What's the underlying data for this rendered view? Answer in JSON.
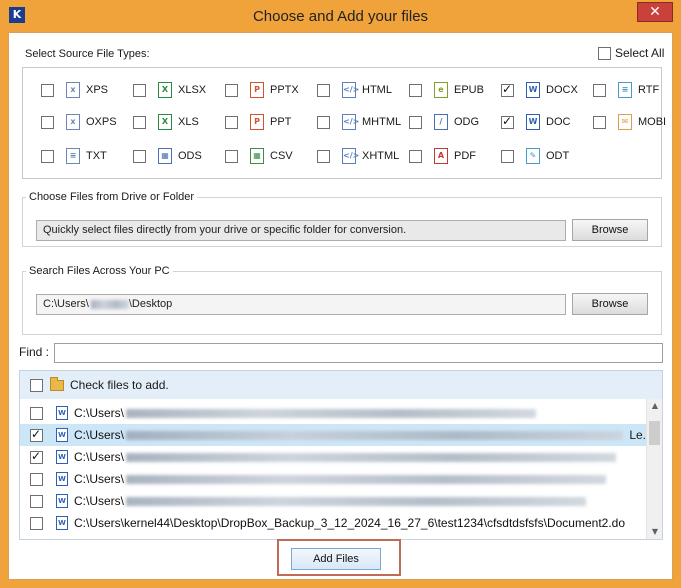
{
  "window": {
    "title": "Choose and Add your files",
    "logo_letter": "K",
    "close_glyph": "✕"
  },
  "source": {
    "label": "Select Source File Types:",
    "select_all": {
      "label": "Select All",
      "checked": false
    },
    "types": [
      {
        "name": "XPS",
        "icon": "xps-file-icon",
        "glyph": "x",
        "checked": false
      },
      {
        "name": "XLSX",
        "icon": "xlsx-file-icon",
        "glyph": "X",
        "checked": false
      },
      {
        "name": "PPTX",
        "icon": "pptx-file-icon",
        "glyph": "P",
        "checked": false
      },
      {
        "name": "HTML",
        "icon": "html-file-icon",
        "glyph": "</>",
        "checked": false
      },
      {
        "name": "EPUB",
        "icon": "epub-file-icon",
        "glyph": "e",
        "checked": false
      },
      {
        "name": "DOCX",
        "icon": "docx-file-icon",
        "glyph": "W",
        "checked": true
      },
      {
        "name": "RTF",
        "icon": "rtf-file-icon",
        "glyph": "≡",
        "checked": false
      },
      {
        "name": "OXPS",
        "icon": "oxps-file-icon",
        "glyph": "x",
        "checked": false
      },
      {
        "name": "XLS",
        "icon": "xls-file-icon",
        "glyph": "X",
        "checked": false
      },
      {
        "name": "PPT",
        "icon": "ppt-file-icon",
        "glyph": "P",
        "checked": false
      },
      {
        "name": "MHTML",
        "icon": "mhtml-file-icon",
        "glyph": "</>",
        "checked": false
      },
      {
        "name": "ODG",
        "icon": "odg-file-icon",
        "glyph": "/",
        "checked": false
      },
      {
        "name": "DOC",
        "icon": "doc-file-icon",
        "glyph": "W",
        "checked": true
      },
      {
        "name": "MOBI",
        "icon": "mobi-file-icon",
        "glyph": "✉",
        "checked": false
      },
      {
        "name": "TXT",
        "icon": "txt-file-icon",
        "glyph": "≡",
        "checked": false
      },
      {
        "name": "ODS",
        "icon": "ods-file-icon",
        "glyph": "▦",
        "checked": false
      },
      {
        "name": "CSV",
        "icon": "csv-file-icon",
        "glyph": "▦",
        "checked": false
      },
      {
        "name": "XHTML",
        "icon": "xhtml-file-icon",
        "glyph": "</>",
        "checked": false
      },
      {
        "name": "PDF",
        "icon": "pdf-file-icon",
        "glyph": "A",
        "checked": false
      },
      {
        "name": "ODT",
        "icon": "odt-file-icon",
        "glyph": "✎",
        "checked": false
      }
    ]
  },
  "drive": {
    "label": "Choose Files from Drive or Folder",
    "field_text": "Quickly select files directly from your drive or specific folder for conversion.",
    "browse_label": "Browse"
  },
  "search": {
    "label": "Search Files Across Your PC",
    "path_prefix": "C:\\Users\\",
    "path_suffix": "\\Desktop",
    "browse_label": "Browse"
  },
  "find": {
    "label": "Find :",
    "value": ""
  },
  "files": {
    "header_label": "Check files to add.",
    "rows": [
      {
        "prefix": "C:\\Users\\",
        "tail": "",
        "checked": false,
        "selected": false
      },
      {
        "prefix": "C:\\Users\\",
        "tail": "Le.",
        "checked": true,
        "selected": true
      },
      {
        "prefix": "C:\\Users\\",
        "tail": "",
        "checked": true,
        "selected": false
      },
      {
        "prefix": "C:\\Users\\",
        "tail": "",
        "checked": false,
        "selected": false
      },
      {
        "prefix": "C:\\Users\\",
        "tail": "",
        "checked": false,
        "selected": false
      },
      {
        "prefix": "C:\\Users\\kernel44\\Desktop\\DropBox_Backup_3_12_2024_16_27_6\\test1234\\cfsdtdsfsfs\\Document2.do",
        "tail": "",
        "checked": false,
        "selected": false
      }
    ]
  },
  "add_button": {
    "label": "Add Files"
  }
}
